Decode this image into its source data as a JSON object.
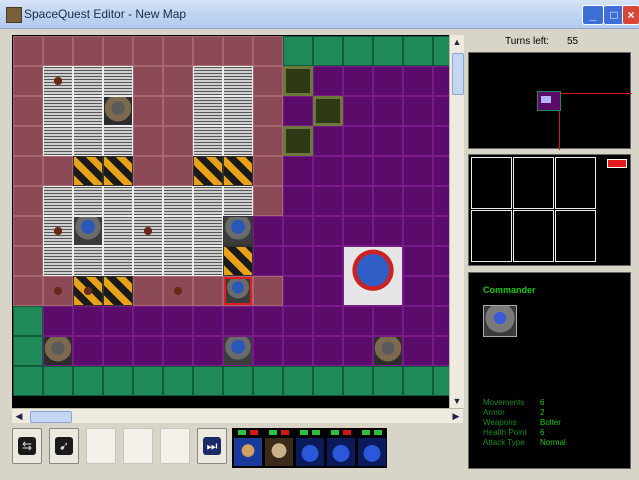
{
  "window": {
    "title": "SpaceQuest Editor - New Map",
    "min_label": "_",
    "max_label": "□",
    "close_label": "×"
  },
  "status": {
    "turns_label": "Turns left:",
    "turns_value": "55"
  },
  "unit_info": {
    "name": "Commander",
    "stats": [
      {
        "label": "Movements",
        "value": "6"
      },
      {
        "label": "Armor",
        "value": "2"
      },
      {
        "label": "Weapons",
        "value": "Bolter"
      },
      {
        "label": "Health Point",
        "value": "6"
      },
      {
        "label": "Attack Type",
        "value": "Normal"
      }
    ]
  },
  "toolbar": {
    "tools": [
      {
        "name": "move-tool",
        "icon": "run-icon"
      },
      {
        "name": "attack-tool",
        "icon": "shoot-icon"
      },
      {
        "name": "empty-slot-1",
        "icon": ""
      },
      {
        "name": "empty-slot-2",
        "icon": ""
      },
      {
        "name": "empty-slot-3",
        "icon": ""
      },
      {
        "name": "end-turn",
        "icon": "fast-forward-icon"
      }
    ],
    "end_turn_glyph": "⏭",
    "run_glyph": "⇆",
    "shoot_glyph": "➹"
  },
  "scroll": {
    "left_arrow": "◀",
    "right_arrow": "▶",
    "up_arrow": "▲",
    "down_arrow": "▼"
  },
  "colors": {
    "floor_red": "#8b4a55",
    "floor_purple": "#5b0c6b",
    "wall_green": "#1f8a58",
    "selection": "#e01c1c",
    "hud_green": "#18c818"
  }
}
